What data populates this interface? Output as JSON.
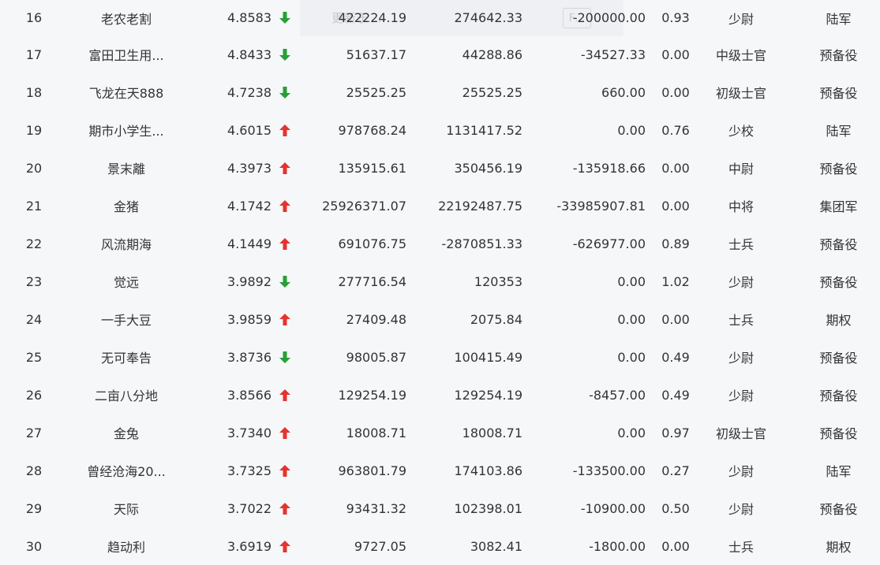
{
  "colors": {
    "up": "#e5332e",
    "down": "#26a035",
    "text": "#333333",
    "background": "#f6f7f9"
  },
  "overlay": {
    "text": "更新于 …",
    "button_label": "F…"
  },
  "rows": [
    {
      "rank": "16",
      "name": "老农老割",
      "score": "4.8583",
      "trend": "down",
      "v1": "422224.19",
      "v2": "274642.33",
      "v3": "-200000.00",
      "ratio": "0.93",
      "level": "少尉",
      "type": "陆军"
    },
    {
      "rank": "17",
      "name": "富田卫生用...",
      "score": "4.8433",
      "trend": "down",
      "v1": "51637.17",
      "v2": "44288.86",
      "v3": "-34527.33",
      "ratio": "0.00",
      "level": "中级士官",
      "type": "预备役"
    },
    {
      "rank": "18",
      "name": "飞龙在天888",
      "score": "4.7238",
      "trend": "down",
      "v1": "25525.25",
      "v2": "25525.25",
      "v3": "660.00",
      "ratio": "0.00",
      "level": "初级士官",
      "type": "预备役"
    },
    {
      "rank": "19",
      "name": "期市小学生...",
      "score": "4.6015",
      "trend": "up",
      "v1": "978768.24",
      "v2": "1131417.52",
      "v3": "0.00",
      "ratio": "0.76",
      "level": "少校",
      "type": "陆军"
    },
    {
      "rank": "20",
      "name": "景末離",
      "score": "4.3973",
      "trend": "up",
      "v1": "135915.61",
      "v2": "350456.19",
      "v3": "-135918.66",
      "ratio": "0.00",
      "level": "中尉",
      "type": "预备役"
    },
    {
      "rank": "21",
      "name": "金猪",
      "score": "4.1742",
      "trend": "up",
      "v1": "25926371.07",
      "v2": "22192487.75",
      "v3": "-33985907.81",
      "ratio": "0.00",
      "level": "中将",
      "type": "集团军"
    },
    {
      "rank": "22",
      "name": "风流期海",
      "score": "4.1449",
      "trend": "up",
      "v1": "691076.75",
      "v2": "-2870851.33",
      "v3": "-626977.00",
      "ratio": "0.89",
      "level": "士兵",
      "type": "预备役"
    },
    {
      "rank": "23",
      "name": "觉远",
      "score": "3.9892",
      "trend": "down",
      "v1": "277716.54",
      "v2": "120353",
      "v3": "0.00",
      "ratio": "1.02",
      "level": "少尉",
      "type": "预备役"
    },
    {
      "rank": "24",
      "name": "一手大豆",
      "score": "3.9859",
      "trend": "up",
      "v1": "27409.48",
      "v2": "2075.84",
      "v3": "0.00",
      "ratio": "0.00",
      "level": "士兵",
      "type": "期权"
    },
    {
      "rank": "25",
      "name": "无可奉告",
      "score": "3.8736",
      "trend": "down",
      "v1": "98005.87",
      "v2": "100415.49",
      "v3": "0.00",
      "ratio": "0.49",
      "level": "少尉",
      "type": "预备役"
    },
    {
      "rank": "26",
      "name": "二亩八分地",
      "score": "3.8566",
      "trend": "up",
      "v1": "129254.19",
      "v2": "129254.19",
      "v3": "-8457.00",
      "ratio": "0.49",
      "level": "少尉",
      "type": "预备役"
    },
    {
      "rank": "27",
      "name": "金兔",
      "score": "3.7340",
      "trend": "up",
      "v1": "18008.71",
      "v2": "18008.71",
      "v3": "0.00",
      "ratio": "0.97",
      "level": "初级士官",
      "type": "预备役"
    },
    {
      "rank": "28",
      "name": "曾经沧海20...",
      "score": "3.7325",
      "trend": "up",
      "v1": "963801.79",
      "v2": "174103.86",
      "v3": "-133500.00",
      "ratio": "0.27",
      "level": "少尉",
      "type": "陆军"
    },
    {
      "rank": "29",
      "name": "天际",
      "score": "3.7022",
      "trend": "up",
      "v1": "93431.32",
      "v2": "102398.01",
      "v3": "-10900.00",
      "ratio": "0.50",
      "level": "少尉",
      "type": "预备役"
    },
    {
      "rank": "30",
      "name": "趋动利",
      "score": "3.6919",
      "trend": "up",
      "v1": "9727.05",
      "v2": "3082.41",
      "v3": "-1800.00",
      "ratio": "0.00",
      "level": "士兵",
      "type": "期权"
    }
  ]
}
